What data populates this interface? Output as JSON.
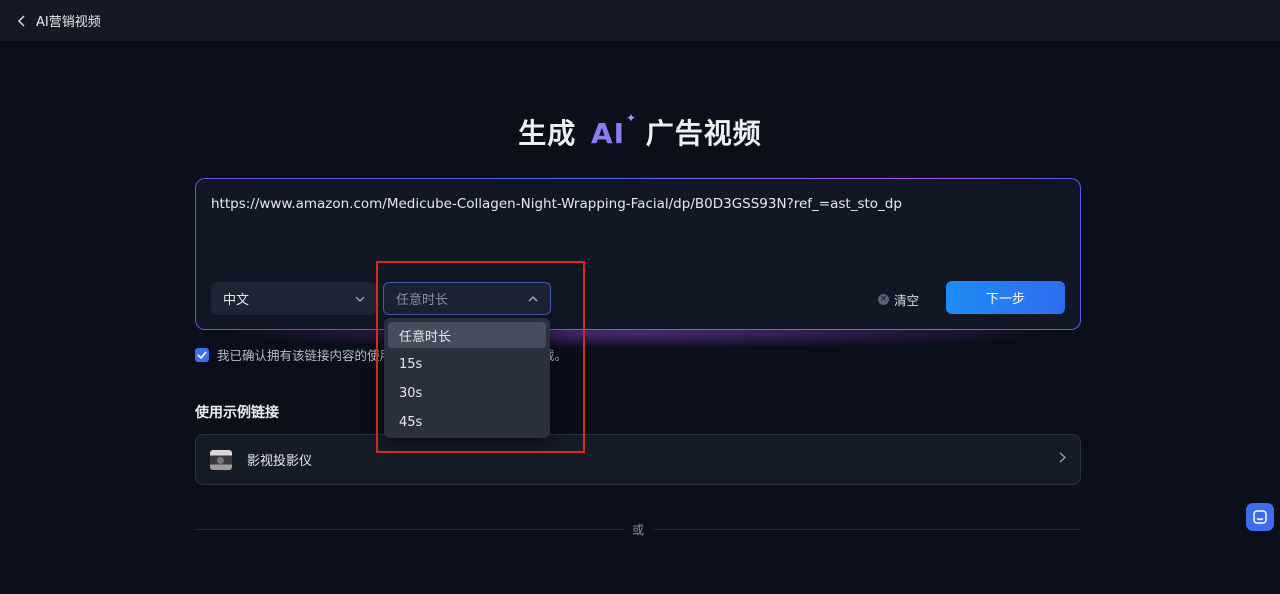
{
  "header": {
    "title": "AI营销视频"
  },
  "headline": {
    "before": "生成",
    "ai": "AI",
    "spark": "✦",
    "after": "广告视频"
  },
  "input": {
    "url": "https://www.amazon.com/Medicube-Collagen-Night-Wrapping-Facial/dp/B0D3GSS93N?ref_=ast_sto_dp"
  },
  "language_select": {
    "value": "中文"
  },
  "duration_select": {
    "value": "任意时长",
    "options": [
      "任意时长",
      "15s",
      "30s",
      "45s"
    ]
  },
  "actions": {
    "clear_label": "清空",
    "next_label": "下一步"
  },
  "consent": {
    "checked": true,
    "text_start": "我已确认拥有该链接内容的使用",
    "text_end": "载。"
  },
  "examples": {
    "title": "使用示例链接",
    "items": [
      {
        "label": "影视投影仪"
      }
    ]
  },
  "divider": {
    "or_label": "或"
  },
  "colors": {
    "accent": "#3d6df2",
    "ai_purple": "#8b7cf6",
    "highlight": "#d8281f",
    "background": "#0b0f1a"
  }
}
